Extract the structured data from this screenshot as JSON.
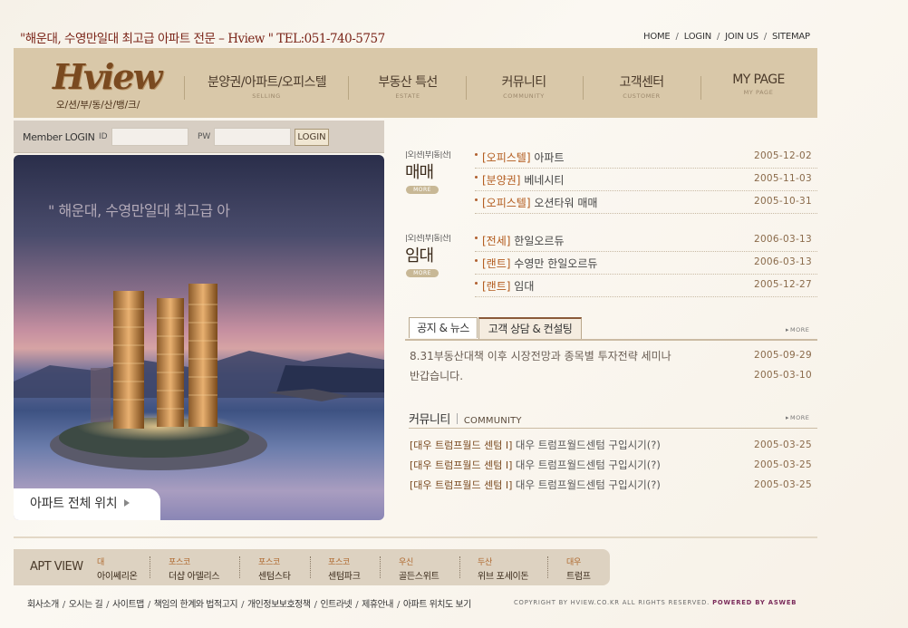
{
  "tagline": "\"해운대, 수영만일대 최고급 아파트 전문 – Hview \" TEL:051-740-5757",
  "top_nav": [
    "HOME",
    "LOGIN",
    "JOIN US",
    "SITEMAP"
  ],
  "logo": {
    "script": "Hview",
    "sub": "오/션/부/동/산/뱅/크/"
  },
  "main_nav": [
    {
      "ko": "분양권/아파트/오피스텔",
      "en": "SELLING"
    },
    {
      "ko": "부동산 특선",
      "en": "ESTATE"
    },
    {
      "ko": "커뮤니티",
      "en": "COMMUNITY"
    },
    {
      "ko": "고객센터",
      "en": "CUSTOMER"
    },
    {
      "ko": "MY PAGE",
      "en": "MY PAGE"
    }
  ],
  "login": {
    "label": "Member LOGIN",
    "id_label": "ID",
    "pw_label": "PW",
    "button": "LOGIN",
    "id_value": "",
    "pw_value": ""
  },
  "hero": {
    "text": "\" 해운대, 수영만일대 최고급 아",
    "button": "아파트 전체 위치"
  },
  "sale": {
    "tiny": "|오|션|부|동|산|",
    "title": "매매",
    "more": "MORE",
    "items": [
      {
        "cat": "[오피스텔]",
        "title": "아파트",
        "date": "2005-12-02"
      },
      {
        "cat": "[분양권]",
        "title": "베네시티",
        "date": "2005-11-03"
      },
      {
        "cat": "[오피스텔]",
        "title": "오션타워 매매",
        "date": "2005-10-31"
      }
    ]
  },
  "rent": {
    "tiny": "|오|션|부|동|산|",
    "title": "임대",
    "more": "MORE",
    "items": [
      {
        "cat": "[전세]",
        "title": "한일오르듀",
        "date": "2006-03-13"
      },
      {
        "cat": "[랜트]",
        "title": "수영만 한일오르듀",
        "date": "2006-03-13"
      },
      {
        "cat": "[랜트]",
        "title": "임대",
        "date": "2005-12-27"
      }
    ]
  },
  "tabs": {
    "items": [
      "공지 & 뉴스",
      "고객 상담 & 컨설팅"
    ],
    "more": "MORE"
  },
  "notices": [
    {
      "title": "8.31부동산대책 이후 시장전망과 종목별 투자전략 세미나",
      "date": "2005-09-29"
    },
    {
      "title": "반갑습니다.",
      "date": "2005-03-10"
    }
  ],
  "community": {
    "ko": "커뮤니티",
    "en": "COMMUNITY",
    "more": "MORE",
    "items": [
      {
        "tag": "[대우 트럼프월드 센텀 I]",
        "title": "대우 트럼프월드센텀 구입시기(?)",
        "date": "2005-03-25"
      },
      {
        "tag": "[대우 트럼프월드 센텀 I]",
        "title": "대우 트럼프월드센텀 구입시기(?)",
        "date": "2005-03-25"
      },
      {
        "tag": "[대우 트럼프월드 센텀 I]",
        "title": "대우 트럼프월드센텀 구입시기(?)",
        "date": "2005-03-25"
      }
    ]
  },
  "apt_view": {
    "label": "APT VIEW",
    "items": [
      {
        "brand": "대",
        "name": "아이쎄리온"
      },
      {
        "brand": "포스코",
        "name": "더샵 아델리스"
      },
      {
        "brand": "포스코",
        "name": "센텀스타"
      },
      {
        "brand": "포스코",
        "name": "센텀파크"
      },
      {
        "brand": "우신",
        "name": "골든스위트"
      },
      {
        "brand": "두산",
        "name": "위브 포세이돈"
      },
      {
        "brand": "대우",
        "name": "트럼프"
      }
    ]
  },
  "footer": {
    "links": [
      "회사소개",
      "오시는 길",
      "사이트맵",
      "책임의 한계와 법적고지",
      "개인정보보호정책",
      "인트라넷",
      "제휴안내",
      "아파트 위치도 보기"
    ],
    "copyright": "COPYRIGHT BY HVIEW.CO.KR   ALL RIGHTS RESERVED.",
    "powered": "POWERED BY ASWEB"
  },
  "colors": {
    "header_bg": "#d9c8a9",
    "accent": "#7a2418",
    "category": "#b25a1c"
  }
}
